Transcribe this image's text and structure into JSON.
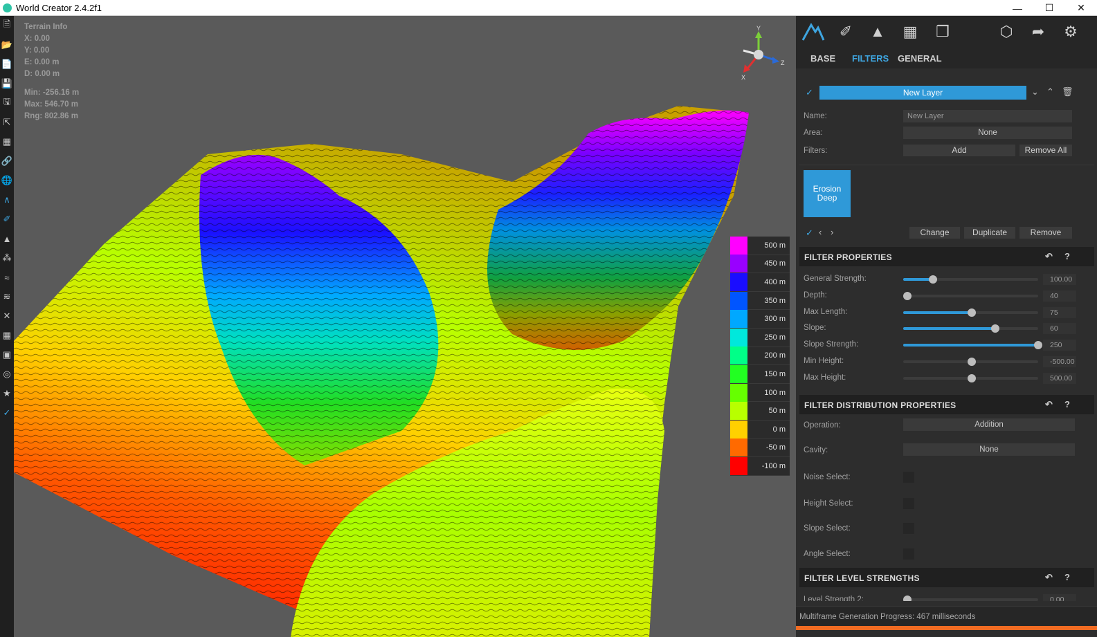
{
  "window": {
    "title": "World Creator 2.4.2f1",
    "minimize": "—",
    "maximize": "☐",
    "close": "✕"
  },
  "left_toolbar": {
    "icons": [
      "new-file-icon",
      "open-folder-icon",
      "open-file-icon",
      "save-icon",
      "save-as-icon",
      "export-icon",
      "map-icon",
      "link-icon",
      "globe-icon",
      "mountain-icon",
      "brush-icon",
      "grass-icon",
      "plants-icon",
      "river-icon",
      "erosion-icon",
      "transform-icon",
      "grid-icon",
      "image-icon",
      "sphere-icon",
      "star-icon",
      "tool-icon"
    ]
  },
  "viewport": {
    "terrain_info": {
      "title": "Terrain Info",
      "x": "X: 0.00",
      "y": "Y: 0.00",
      "e": "E: 0.00 m",
      "d": "D: 0.00 m",
      "min": "Min: -256.16 m",
      "max": "Max: 546.70 m",
      "rng": "Rng: 802.86 m"
    },
    "gizmo": {
      "y": "Y",
      "z": "Z",
      "x": "X"
    },
    "legend": [
      {
        "label": "500 m",
        "color": "#ff00ff"
      },
      {
        "label": "450 m",
        "color": "#9900ff"
      },
      {
        "label": "400 m",
        "color": "#1a0dff"
      },
      {
        "label": "350 m",
        "color": "#0055ff"
      },
      {
        "label": "300 m",
        "color": "#00a8ff"
      },
      {
        "label": "250 m",
        "color": "#00e8dc"
      },
      {
        "label": "200 m",
        "color": "#00ff88"
      },
      {
        "label": "150 m",
        "color": "#22ff22"
      },
      {
        "label": "100 m",
        "color": "#66ff00"
      },
      {
        "label": "50 m",
        "color": "#b8ff00"
      },
      {
        "label": "0 m",
        "color": "#ffd000"
      },
      {
        "label": "-50 m",
        "color": "#ff6a00"
      },
      {
        "label": "-100 m",
        "color": "#ff0000"
      }
    ]
  },
  "panel": {
    "top_icons": [
      "terrain-icon",
      "paint-tool-icon",
      "forest-icon",
      "map-icon",
      "layers-icon",
      "cube-icon",
      "share-icon",
      "settings-icon"
    ],
    "tabs": {
      "base": "BASE",
      "filters": "FILTERS",
      "general": "GENERAL"
    },
    "layer": {
      "name_bar": "New Layer",
      "name_label": "Name:",
      "name_value": "New Layer",
      "area_label": "Area:",
      "area_value": "None",
      "filters_label": "Filters:",
      "add": "Add",
      "remove_all": "Remove All"
    },
    "filter_tile": "Erosion Deep",
    "filter_actions": {
      "change": "Change",
      "duplicate": "Duplicate",
      "remove": "Remove"
    },
    "filter_properties": {
      "title": "FILTER PROPERTIES",
      "rows": [
        {
          "label": "General Strength:",
          "value": "100.00",
          "level": 0.22,
          "fill": true
        },
        {
          "label": "Depth:",
          "value": "40",
          "level": 0.03,
          "fill": false
        },
        {
          "label": "Max Length:",
          "value": "75",
          "level": 0.51,
          "fill": true
        },
        {
          "label": "Slope:",
          "value": "60",
          "level": 0.68,
          "fill": true
        },
        {
          "label": "Slope Strength:",
          "value": "250",
          "level": 1.0,
          "fill": true
        },
        {
          "label": "Min Height:",
          "value": "-500.00",
          "level": 0.51,
          "fill": false
        },
        {
          "label": "Max Height:",
          "value": "500.00",
          "level": 0.51,
          "fill": false
        }
      ]
    },
    "distribution": {
      "title": "FILTER DISTRIBUTION PROPERTIES",
      "operation_label": "Operation:",
      "operation_value": "Addition",
      "cavity_label": "Cavity:",
      "cavity_value": "None",
      "noise_select": "Noise Select:",
      "height_select": "Height Select:",
      "slope_select": "Slope Select:",
      "angle_select": "Angle Select:"
    },
    "level_strengths": {
      "title": "FILTER LEVEL STRENGTHS",
      "row_label": "Level Strength 2:",
      "row_value": "0.00"
    },
    "status": "Multiframe Generation Progress: 467 milliseconds"
  }
}
